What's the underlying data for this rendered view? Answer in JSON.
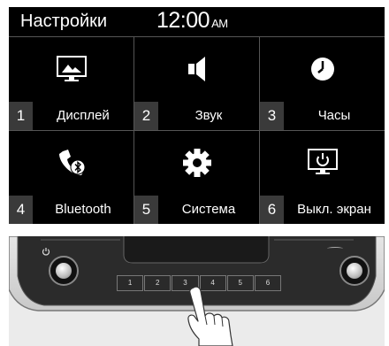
{
  "header": {
    "title": "Настройки",
    "time": "12:00",
    "ampm": "AM"
  },
  "tiles": [
    {
      "number": "1",
      "label": "Дисплей",
      "icon": "display-icon"
    },
    {
      "number": "2",
      "label": "Звук",
      "icon": "speaker-icon"
    },
    {
      "number": "3",
      "label": "Часы",
      "icon": "clock-icon"
    },
    {
      "number": "4",
      "label": "Bluetooth",
      "icon": "bluetooth-phone-icon"
    },
    {
      "number": "5",
      "label": "Система",
      "icon": "gear-icon"
    },
    {
      "number": "6",
      "label": "Выкл. экран",
      "icon": "screen-off-icon"
    }
  ],
  "panel": {
    "buttons": [
      "1",
      "2",
      "3",
      "4",
      "5",
      "6"
    ]
  },
  "colors": {
    "screen_bg": "#000000",
    "divider": "#555555",
    "number_box": "#3a3a3a"
  }
}
